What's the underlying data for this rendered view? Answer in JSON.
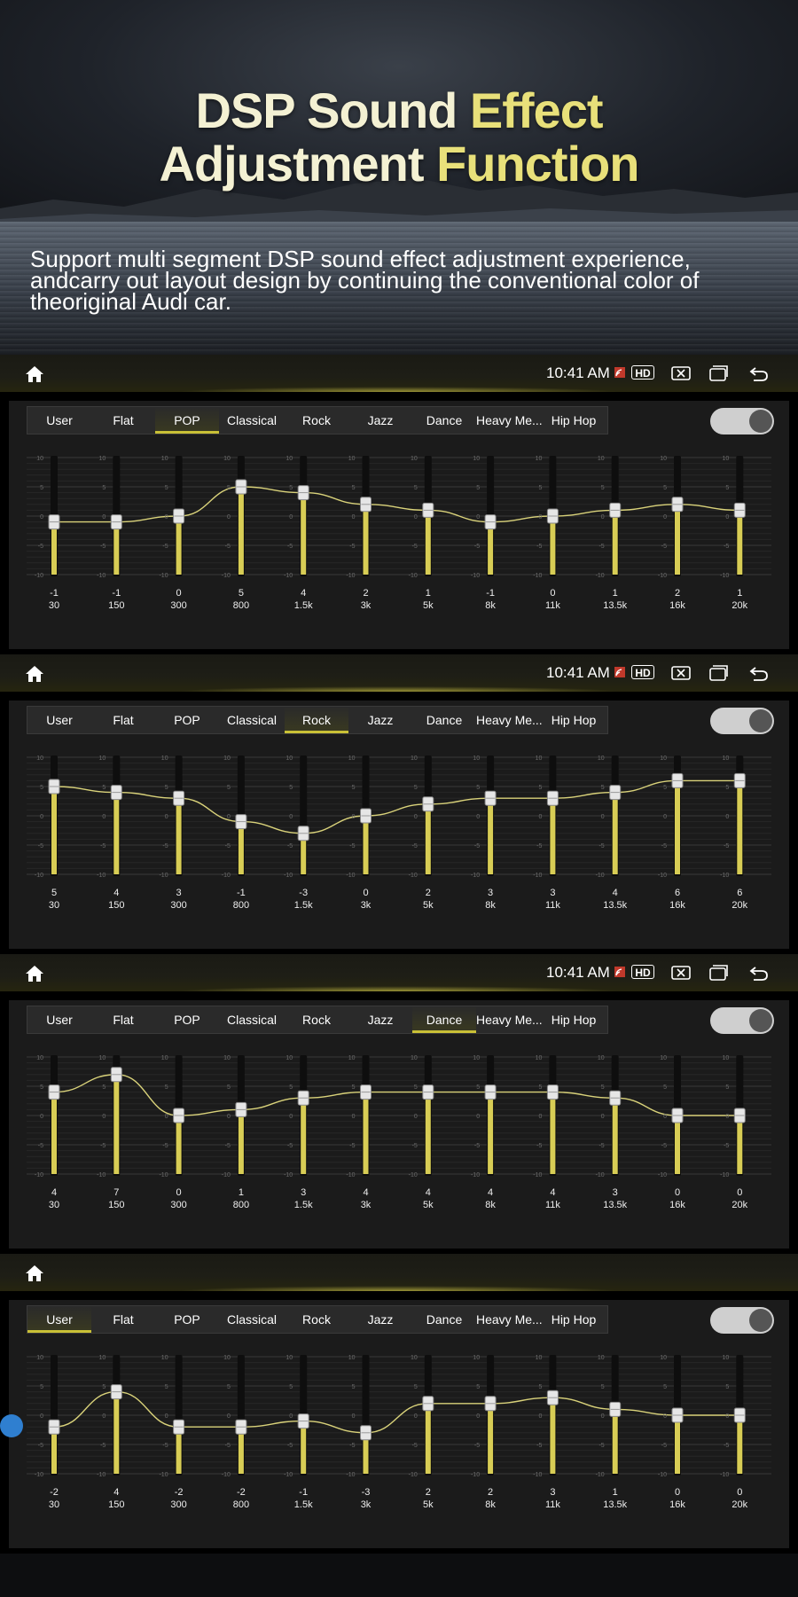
{
  "hero": {
    "title_line1_white": "DSP Sound ",
    "title_line1_yellow": "Effect",
    "title_line2_white": "Adjustment ",
    "title_line2_yellow": "Function",
    "subtitle": "Support multi segment DSP sound effect adjustment experience, andcarry out layout design by continuing the conventional color of theoriginal Audi car."
  },
  "colors": {
    "accent": "#c9c036",
    "curve": "#d9d27a",
    "slider_fill": "#d8cd55"
  },
  "presets": [
    "User",
    "Flat",
    "POP",
    "Classical",
    "Rock",
    "Jazz",
    "Dance",
    "Heavy Me...",
    "Hip Hop"
  ],
  "frequencies": [
    "30",
    "150",
    "300",
    "800",
    "1.5k",
    "3k",
    "5k",
    "8k",
    "11k",
    "13.5k",
    "16k",
    "20k"
  ],
  "panels": [
    {
      "status": {
        "time": "10:41 AM",
        "hd": "HD",
        "show_icons": true
      },
      "active_preset": 2,
      "toggle_on": true,
      "values": [
        -1,
        -1,
        0,
        5,
        4,
        2,
        1,
        -1,
        0,
        1,
        2,
        1
      ]
    },
    {
      "status": {
        "time": "10:41 AM",
        "hd": "HD",
        "show_icons": true
      },
      "active_preset": 4,
      "toggle_on": true,
      "values": [
        5,
        4,
        3,
        -1,
        -3,
        0,
        2,
        3,
        3,
        4,
        6,
        6
      ]
    },
    {
      "status": {
        "time": "10:41 AM",
        "hd": "HD",
        "show_icons": true
      },
      "active_preset": 6,
      "toggle_on": true,
      "values": [
        4,
        7,
        0,
        1,
        3,
        4,
        4,
        4,
        4,
        3,
        0,
        0
      ]
    },
    {
      "status": {
        "time": "",
        "hd": "",
        "show_icons": false
      },
      "active_preset": 0,
      "toggle_on": true,
      "values": [
        -2,
        4,
        -2,
        -2,
        -1,
        -3,
        2,
        2,
        3,
        1,
        0,
        0
      ]
    }
  ],
  "scale": {
    "min": -10,
    "max": 10,
    "ticks": [
      "10",
      "5",
      "0",
      "-5",
      "-10"
    ]
  },
  "icons": {
    "home": "home-icon",
    "signal": "signal-icon",
    "window": "window-close-icon",
    "recent": "recent-apps-icon",
    "back": "back-icon"
  }
}
